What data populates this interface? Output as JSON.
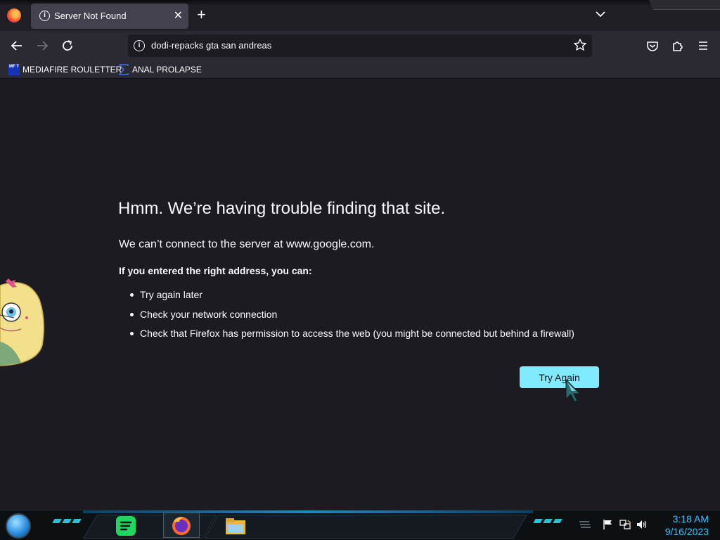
{
  "browser": {
    "tab": {
      "title": "Server Not Found",
      "close": "✕"
    },
    "new_tab": "+",
    "url": "dodi-repacks gta san andreas",
    "bookmarks": [
      {
        "label": "MEDIAFIRE ROULETTER",
        "icon": "mft-icon",
        "icon_text": "MF T"
      },
      {
        "label": "ANAL PROLAPSE",
        "icon": "sigma-icon"
      }
    ]
  },
  "error_page": {
    "title": "Hmm. We’re having trouble finding that site.",
    "subtitle": "We can’t connect to the server at www.google.com.",
    "intro": "If you entered the right address, you can:",
    "suggestions": [
      "Try again later",
      "Check your network connection",
      "Check that Firefox has permission to access the web (you might be connected but behind a firewall)"
    ],
    "try_again_label": "Try Again"
  },
  "taskbar": {
    "time": "3:18 AM",
    "date": "9/16/2023",
    "apps": [
      "spotify-icon",
      "firefox-icon",
      "file-explorer-icon"
    ]
  },
  "colors": {
    "page_bg": "#1c1b22",
    "toolbar_bg": "#2b2a33",
    "tab_active": "#42414d",
    "button_accent": "#80ebff",
    "clock": "#3ac0ff"
  }
}
